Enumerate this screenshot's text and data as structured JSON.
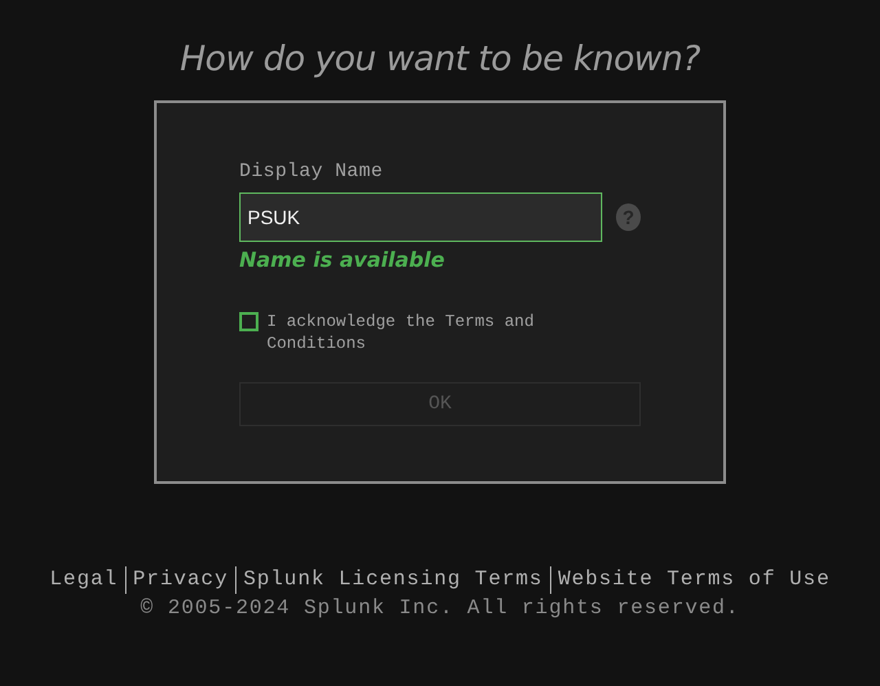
{
  "heading": "How do you want to be known?",
  "form": {
    "label": "Display Name",
    "value": "PSUK",
    "help": "?",
    "status": "Name is available",
    "available": true,
    "terms": {
      "label": "I acknowledge the Terms and Conditions",
      "checked": false
    },
    "submit": {
      "label": "OK",
      "disabled": true
    }
  },
  "footer": {
    "links": [
      "Legal",
      "Privacy",
      "Splunk Licensing Terms",
      "Website Terms of Use"
    ],
    "copyright": "© 2005-2024 Splunk Inc. All rights reserved."
  }
}
